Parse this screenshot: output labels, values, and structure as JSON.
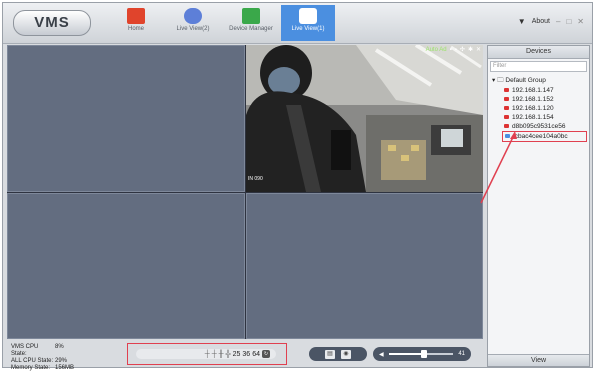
{
  "app": {
    "logo": "VMS",
    "tabs": [
      {
        "label": "Home",
        "icon": "home-icon",
        "color": "#e0442c"
      },
      {
        "label": "Live View(2)",
        "icon": "live-view-icon",
        "color": "#5d7fd8"
      },
      {
        "label": "Device Manager",
        "icon": "device-manager-icon",
        "color": "#3aa84a"
      },
      {
        "label": "Live View(1)",
        "icon": "live-view-icon",
        "color": "#3d76d8"
      }
    ],
    "active_tab": 3,
    "about": "About"
  },
  "camera": {
    "toolbar_text": "Auto Ad",
    "timestamp": "IN 090"
  },
  "devices": {
    "title": "Devices",
    "filter_placeholder": "Filter",
    "group": "Default Group",
    "items": [
      "192.168.1.147",
      "192.168.1.152",
      "192.168.1.120",
      "192.168.1.154",
      "d8b095c9531ce56",
      "fcbac4cee104a0bc"
    ],
    "selected_index": 5,
    "view_tab": "View"
  },
  "status": {
    "vms_cpu_label": "VMS CPU State:",
    "vms_cpu": "8%",
    "all_cpu_label": "ALL CPU State:",
    "all_cpu": "29%",
    "memory_label": "Memory State:",
    "memory": "156MB"
  },
  "layout_options": [
    "25",
    "36",
    "64"
  ],
  "volume": {
    "value": 41,
    "level": 0.55
  },
  "colors": {
    "highlight": "#e04050",
    "accent": "#4b8fe0"
  }
}
